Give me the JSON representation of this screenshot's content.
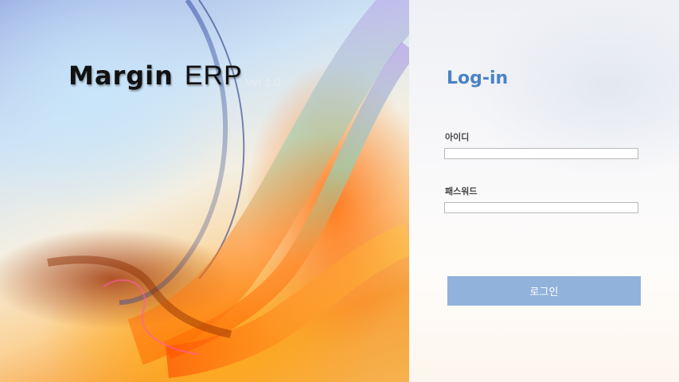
{
  "brand": {
    "name": "Margin",
    "suffix": "ERP",
    "version": "Ver 1.0"
  },
  "login": {
    "title": "Log-in",
    "id_label": "아이디",
    "id_value": "",
    "password_label": "패스워드",
    "password_value": "",
    "button_label": "로그인"
  },
  "colors": {
    "title": "#4c82c6",
    "button": "#91b2db"
  }
}
